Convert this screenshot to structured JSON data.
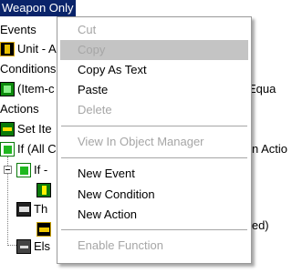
{
  "tree": {
    "title": "Weapon Only",
    "events_label": "Events",
    "unit_event": "Unit - A",
    "conditions_label": "Conditions",
    "condition_item": "(Item-c",
    "condition_tail": "Equa",
    "actions_label": "Actions",
    "set_item": "Set Ite",
    "if_all": "If (All C",
    "if_all_tail": "n Actio",
    "if_sub": "If -",
    "then_label": "Th",
    "crown_tail": "ated)",
    "else_label": "Els"
  },
  "context_menu": {
    "items": [
      {
        "label": "Cut",
        "enabled": false
      },
      {
        "label": "Copy",
        "enabled": false,
        "highlighted": true
      },
      {
        "label": "Copy As Text",
        "enabled": true
      },
      {
        "label": "Paste",
        "enabled": true
      },
      {
        "label": "Delete",
        "enabled": false
      },
      {
        "label": "View In Object Manager",
        "enabled": false
      },
      {
        "label": "New Event",
        "enabled": true
      },
      {
        "label": "New Condition",
        "enabled": true
      },
      {
        "label": "New Action",
        "enabled": true
      },
      {
        "label": "Enable Function",
        "enabled": false
      }
    ]
  },
  "colors": {
    "selection": "#0a246a",
    "menu_highlight": "#c4c4c4",
    "disabled_text": "#a6a6a6"
  }
}
